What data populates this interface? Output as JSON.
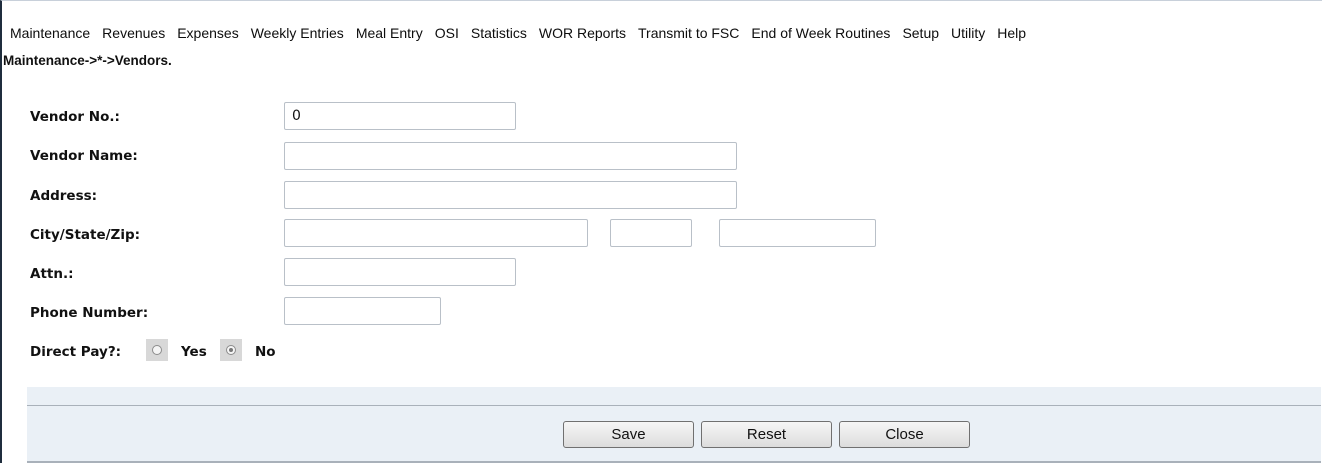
{
  "menu": [
    "Maintenance",
    "Revenues",
    "Expenses",
    "Weekly Entries",
    "Meal Entry",
    "OSI",
    "Statistics",
    "WOR Reports",
    "Transmit to FSC",
    "End of Week Routines",
    "Setup",
    "Utility",
    "Help"
  ],
  "breadcrumb": "Maintenance->*->Vendors.",
  "form": {
    "vendor_no_label": "Vendor No.:",
    "vendor_no_value": "0",
    "vendor_name_label": "Vendor Name:",
    "vendor_name_value": "",
    "address_label": "Address:",
    "address_value": "",
    "city_state_zip_label": "City/State/Zip:",
    "city_value": "",
    "state_value": "",
    "zip_value": "",
    "attn_label": "Attn.:",
    "attn_value": "",
    "phone_label": "Phone Number:",
    "phone_value": "",
    "direct_pay_label": "Direct Pay?:",
    "direct_pay_yes": "Yes",
    "direct_pay_no": "No",
    "direct_pay_selected": "No"
  },
  "buttons": {
    "save": "Save",
    "reset": "Reset",
    "close": "Close"
  }
}
